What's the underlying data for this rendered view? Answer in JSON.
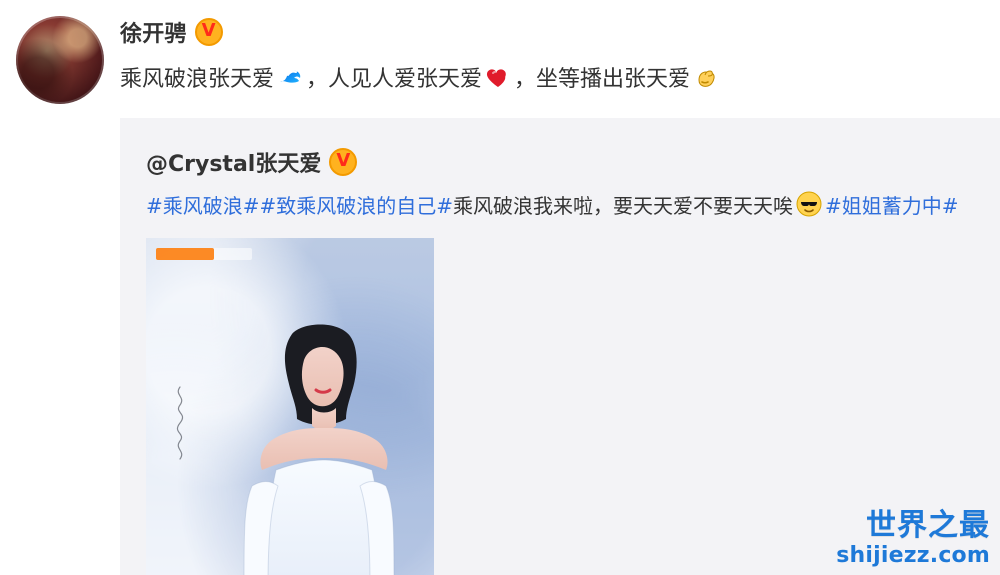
{
  "post": {
    "author": {
      "name": "徐开骋",
      "verified": true
    },
    "segments": [
      {
        "type": "text",
        "text": "乘风破浪张天爱"
      },
      {
        "type": "emoji",
        "name": "wave-icon"
      },
      {
        "type": "text",
        "text": "，人见人爱张天爱"
      },
      {
        "type": "emoji",
        "name": "heart-icon"
      },
      {
        "type": "text",
        "text": "，坐等播出张天爱"
      },
      {
        "type": "emoji",
        "name": "flexed-biceps-icon"
      }
    ]
  },
  "repost": {
    "author": {
      "handle": "@Crystal张天爱",
      "verified": true
    },
    "segments": [
      {
        "type": "hashtag",
        "text": "#乘风破浪#"
      },
      {
        "type": "hashtag",
        "text": "#致乘风破浪的自己#"
      },
      {
        "type": "text",
        "text": " 乘风破浪我来啦，要天天爱不要天天唉"
      },
      {
        "type": "emoji",
        "name": "sunglasses-face-icon"
      },
      {
        "type": "hashtag",
        "text": "#姐姐蓄力中#"
      }
    ]
  },
  "watermark": {
    "title": "世界之最",
    "url": "shijiezz.com"
  },
  "colors": {
    "text_primary": "#333333",
    "hashtag": "#2f6edb",
    "repost_bg": "#f3f3f6",
    "badge_fill": "#ffb21f",
    "badge_v": "#ff2b1a",
    "watermark": "#1e79d8"
  }
}
